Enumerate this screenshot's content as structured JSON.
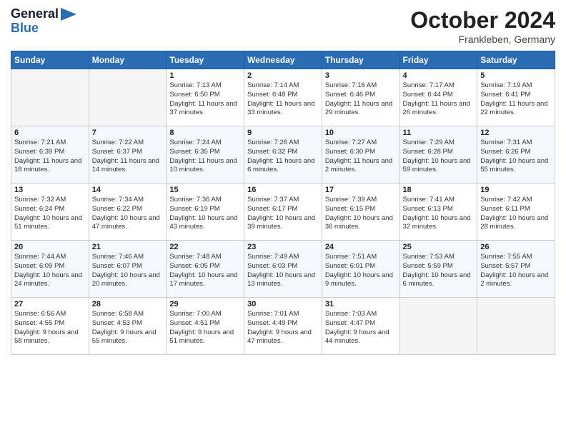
{
  "logo": {
    "text_general": "General",
    "text_blue": "Blue",
    "arrow_color": "#2a6db5"
  },
  "title": "October 2024",
  "location": "Frankleben, Germany",
  "days_of_week": [
    "Sunday",
    "Monday",
    "Tuesday",
    "Wednesday",
    "Thursday",
    "Friday",
    "Saturday"
  ],
  "weeks": [
    [
      {
        "day": null
      },
      {
        "day": null
      },
      {
        "day": "1",
        "sunrise": "7:13 AM",
        "sunset": "6:50 PM",
        "daylight": "11 hours and 37 minutes."
      },
      {
        "day": "2",
        "sunrise": "7:14 AM",
        "sunset": "6:48 PM",
        "daylight": "11 hours and 33 minutes."
      },
      {
        "day": "3",
        "sunrise": "7:16 AM",
        "sunset": "6:46 PM",
        "daylight": "11 hours and 29 minutes."
      },
      {
        "day": "4",
        "sunrise": "7:17 AM",
        "sunset": "6:44 PM",
        "daylight": "11 hours and 26 minutes."
      },
      {
        "day": "5",
        "sunrise": "7:19 AM",
        "sunset": "6:41 PM",
        "daylight": "11 hours and 22 minutes."
      }
    ],
    [
      {
        "day": "6",
        "sunrise": "7:21 AM",
        "sunset": "6:39 PM",
        "daylight": "11 hours and 18 minutes."
      },
      {
        "day": "7",
        "sunrise": "7:22 AM",
        "sunset": "6:37 PM",
        "daylight": "11 hours and 14 minutes."
      },
      {
        "day": "8",
        "sunrise": "7:24 AM",
        "sunset": "6:35 PM",
        "daylight": "11 hours and 10 minutes."
      },
      {
        "day": "9",
        "sunrise": "7:26 AM",
        "sunset": "6:32 PM",
        "daylight": "11 hours and 6 minutes."
      },
      {
        "day": "10",
        "sunrise": "7:27 AM",
        "sunset": "6:30 PM",
        "daylight": "11 hours and 2 minutes."
      },
      {
        "day": "11",
        "sunrise": "7:29 AM",
        "sunset": "6:28 PM",
        "daylight": "10 hours and 59 minutes."
      },
      {
        "day": "12",
        "sunrise": "7:31 AM",
        "sunset": "6:26 PM",
        "daylight": "10 hours and 55 minutes."
      }
    ],
    [
      {
        "day": "13",
        "sunrise": "7:32 AM",
        "sunset": "6:24 PM",
        "daylight": "10 hours and 51 minutes."
      },
      {
        "day": "14",
        "sunrise": "7:34 AM",
        "sunset": "6:22 PM",
        "daylight": "10 hours and 47 minutes."
      },
      {
        "day": "15",
        "sunrise": "7:36 AM",
        "sunset": "6:19 PM",
        "daylight": "10 hours and 43 minutes."
      },
      {
        "day": "16",
        "sunrise": "7:37 AM",
        "sunset": "6:17 PM",
        "daylight": "10 hours and 39 minutes."
      },
      {
        "day": "17",
        "sunrise": "7:39 AM",
        "sunset": "6:15 PM",
        "daylight": "10 hours and 36 minutes."
      },
      {
        "day": "18",
        "sunrise": "7:41 AM",
        "sunset": "6:13 PM",
        "daylight": "10 hours and 32 minutes."
      },
      {
        "day": "19",
        "sunrise": "7:42 AM",
        "sunset": "6:11 PM",
        "daylight": "10 hours and 28 minutes."
      }
    ],
    [
      {
        "day": "20",
        "sunrise": "7:44 AM",
        "sunset": "6:09 PM",
        "daylight": "10 hours and 24 minutes."
      },
      {
        "day": "21",
        "sunrise": "7:46 AM",
        "sunset": "6:07 PM",
        "daylight": "10 hours and 20 minutes."
      },
      {
        "day": "22",
        "sunrise": "7:48 AM",
        "sunset": "6:05 PM",
        "daylight": "10 hours and 17 minutes."
      },
      {
        "day": "23",
        "sunrise": "7:49 AM",
        "sunset": "6:03 PM",
        "daylight": "10 hours and 13 minutes."
      },
      {
        "day": "24",
        "sunrise": "7:51 AM",
        "sunset": "6:01 PM",
        "daylight": "10 hours and 9 minutes."
      },
      {
        "day": "25",
        "sunrise": "7:53 AM",
        "sunset": "5:59 PM",
        "daylight": "10 hours and 6 minutes."
      },
      {
        "day": "26",
        "sunrise": "7:55 AM",
        "sunset": "5:57 PM",
        "daylight": "10 hours and 2 minutes."
      }
    ],
    [
      {
        "day": "27",
        "sunrise": "6:56 AM",
        "sunset": "4:55 PM",
        "daylight": "9 hours and 58 minutes."
      },
      {
        "day": "28",
        "sunrise": "6:58 AM",
        "sunset": "4:53 PM",
        "daylight": "9 hours and 55 minutes."
      },
      {
        "day": "29",
        "sunrise": "7:00 AM",
        "sunset": "4:51 PM",
        "daylight": "9 hours and 51 minutes."
      },
      {
        "day": "30",
        "sunrise": "7:01 AM",
        "sunset": "4:49 PM",
        "daylight": "9 hours and 47 minutes."
      },
      {
        "day": "31",
        "sunrise": "7:03 AM",
        "sunset": "4:47 PM",
        "daylight": "9 hours and 44 minutes."
      },
      {
        "day": null
      },
      {
        "day": null
      }
    ]
  ]
}
